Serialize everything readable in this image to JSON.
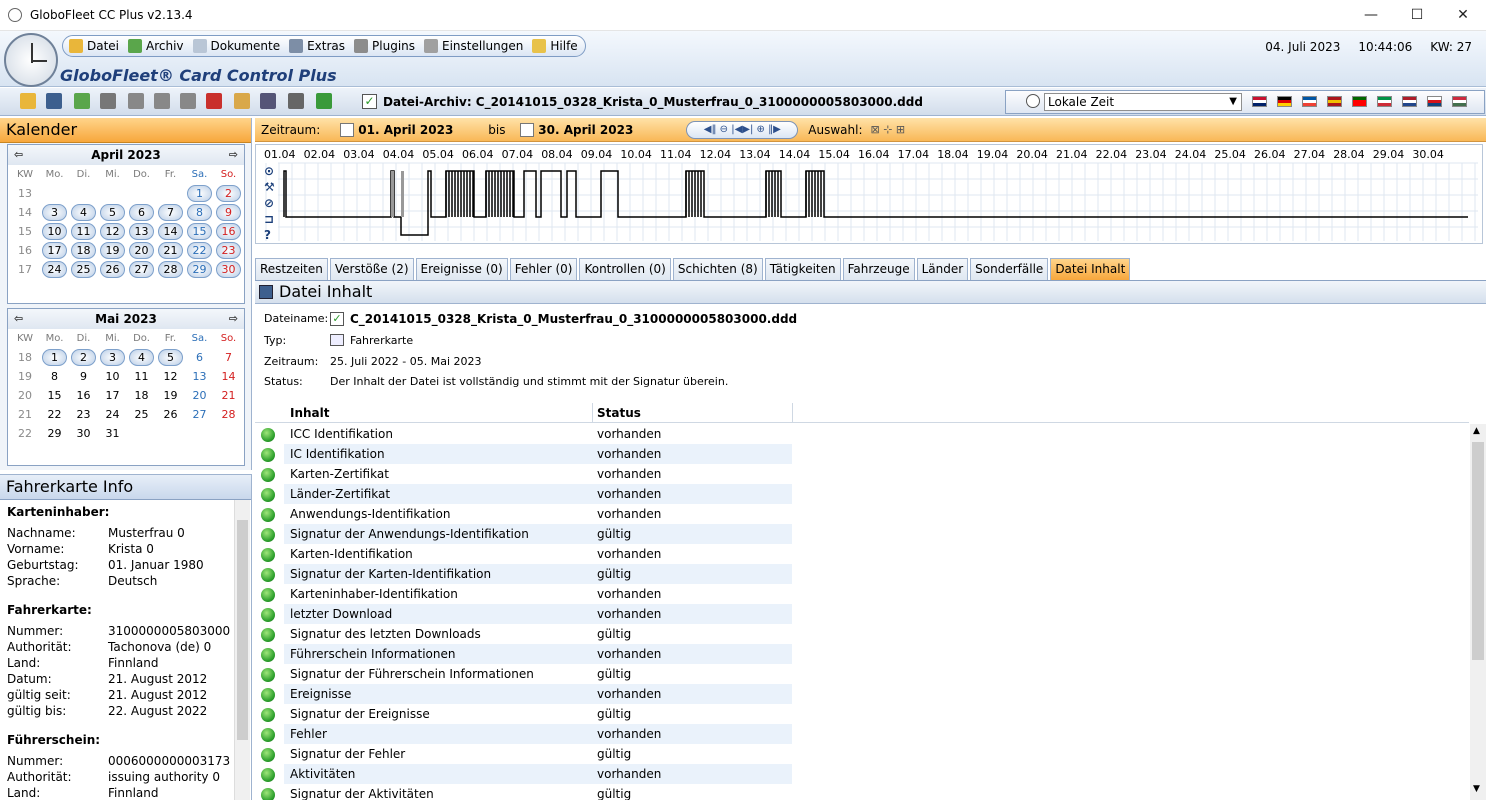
{
  "window": {
    "title": "GloboFleet CC Plus v2.13.4"
  },
  "menu": [
    {
      "label": "Datei",
      "color": "#e9b63a"
    },
    {
      "label": "Archiv",
      "color": "#5aa64b"
    },
    {
      "label": "Dokumente",
      "color": "#b9c6d6"
    },
    {
      "label": "Extras",
      "color": "#7d8ea6"
    },
    {
      "label": "Plugins",
      "color": "#8c8c8c"
    },
    {
      "label": "Einstellungen",
      "color": "#a0a0a0"
    },
    {
      "label": "Hilfe",
      "color": "#e8c24a"
    }
  ],
  "brand": "GloboFleet® Card Control Plus",
  "datetime": {
    "date": "04. Juli 2023",
    "time": "10:44:06",
    "kw": "KW: 27"
  },
  "archive_label": "Datei-Archiv: C_20141015_0328_Krista_0_Musterfrau_0_3100000005803000.ddd",
  "timezone": "Lokale Zeit",
  "calendar": {
    "title": "Kalender",
    "weekday_headers": [
      "KW",
      "Mo.",
      "Di.",
      "Mi.",
      "Do.",
      "Fr.",
      "Sa.",
      "So."
    ],
    "months": [
      {
        "name": "April 2023",
        "weeks": [
          {
            "kw": "13",
            "days": [
              "",
              "",
              "",
              "",
              "",
              "1",
              "2"
            ],
            "hl": [
              0,
              0,
              0,
              0,
              0,
              1,
              1
            ]
          },
          {
            "kw": "14",
            "days": [
              "3",
              "4",
              "5",
              "6",
              "7",
              "8",
              "9"
            ],
            "hl": [
              1,
              1,
              1,
              1,
              1,
              1,
              1
            ]
          },
          {
            "kw": "15",
            "days": [
              "10",
              "11",
              "12",
              "13",
              "14",
              "15",
              "16"
            ],
            "hl": [
              1,
              1,
              1,
              1,
              1,
              1,
              1
            ]
          },
          {
            "kw": "16",
            "days": [
              "17",
              "18",
              "19",
              "20",
              "21",
              "22",
              "23"
            ],
            "hl": [
              1,
              1,
              1,
              1,
              1,
              1,
              1
            ]
          },
          {
            "kw": "17",
            "days": [
              "24",
              "25",
              "26",
              "27",
              "28",
              "29",
              "30"
            ],
            "hl": [
              1,
              1,
              1,
              1,
              1,
              1,
              1
            ]
          }
        ]
      },
      {
        "name": "Mai 2023",
        "weeks": [
          {
            "kw": "18",
            "days": [
              "1",
              "2",
              "3",
              "4",
              "5",
              "6",
              "7"
            ],
            "hl": [
              1,
              1,
              1,
              1,
              1,
              0,
              0
            ]
          },
          {
            "kw": "19",
            "days": [
              "8",
              "9",
              "10",
              "11",
              "12",
              "13",
              "14"
            ],
            "hl": [
              0,
              0,
              0,
              0,
              0,
              0,
              0
            ]
          },
          {
            "kw": "20",
            "days": [
              "15",
              "16",
              "17",
              "18",
              "19",
              "20",
              "21"
            ],
            "hl": [
              0,
              0,
              0,
              0,
              0,
              0,
              0
            ]
          },
          {
            "kw": "21",
            "days": [
              "22",
              "23",
              "24",
              "25",
              "26",
              "27",
              "28"
            ],
            "hl": [
              0,
              0,
              0,
              0,
              0,
              0,
              0
            ]
          },
          {
            "kw": "22",
            "days": [
              "29",
              "30",
              "31",
              "",
              "",
              "",
              ""
            ],
            "hl": [
              0,
              0,
              0,
              0,
              0,
              0,
              0
            ]
          }
        ]
      }
    ]
  },
  "fahrerkarte": {
    "title": "Fahrerkarte Info",
    "sections": [
      {
        "heading": "Karteninhaber:",
        "rows": [
          [
            "Nachname:",
            "Musterfrau 0"
          ],
          [
            "Vorname:",
            "Krista 0"
          ],
          [
            "Geburtstag:",
            "01. Januar 1980"
          ],
          [
            "Sprache:",
            "Deutsch"
          ]
        ]
      },
      {
        "heading": "Fahrerkarte:",
        "rows": [
          [
            "Nummer:",
            "3100000005803000"
          ],
          [
            "Authorität:",
            "Tachonova (de) 0"
          ],
          [
            "Land:",
            "Finnland"
          ],
          [
            "Datum:",
            "21. August 2012"
          ],
          [
            "gültig seit:",
            "21. August 2012"
          ],
          [
            "gültig bis:",
            "22. August 2022"
          ]
        ]
      },
      {
        "heading": "Führerschein:",
        "rows": [
          [
            "Nummer:",
            "0006000000003173"
          ],
          [
            "Authorität:",
            "issuing authority 0"
          ],
          [
            "Land:",
            "Finnland"
          ]
        ]
      }
    ]
  },
  "zeitraum": {
    "label": "Zeitraum:",
    "from": "01. April 2023",
    "bis": "bis",
    "to": "30. April 2023",
    "auswahl": "Auswahl:"
  },
  "timeline": {
    "dates": [
      "01.04",
      "02.04",
      "03.04",
      "04.04",
      "05.04",
      "06.04",
      "07.04",
      "08.04",
      "09.04",
      "10.04",
      "11.04",
      "12.04",
      "13.04",
      "14.04",
      "15.04",
      "16.04",
      "17.04",
      "18.04",
      "19.04",
      "20.04",
      "21.04",
      "22.04",
      "23.04",
      "24.04",
      "25.04",
      "26.04",
      "27.04",
      "28.04",
      "29.04",
      "30.04"
    ],
    "row_icons": [
      "⊙",
      "⚒",
      "⊘",
      "⊐",
      "?"
    ]
  },
  "tabs": [
    "Restzeiten",
    "Verstöße (2)",
    "Ereignisse (0)",
    "Fehler (0)",
    "Kontrollen (0)",
    "Schichten (8)",
    "Tätigkeiten",
    "Fahrzeuge",
    "Länder",
    "Sonderfälle",
    "Datei Inhalt"
  ],
  "active_tab": "Datei Inhalt",
  "datei_inhalt": {
    "title": "Datei Inhalt",
    "dateiname_label": "Dateiname:",
    "dateiname": "C_20141015_0328_Krista_0_Musterfrau_0_3100000005803000.ddd",
    "typ_label": "Typ:",
    "typ": "Fahrerkarte",
    "zeitraum_label": "Zeitraum:",
    "zeitraum": "25. Juli 2022 - 05. Mai 2023",
    "status_label": "Status:",
    "status": "Der Inhalt der Datei ist vollständig und stimmt mit der Signatur überein.",
    "col_inhalt": "Inhalt",
    "col_status": "Status",
    "rows": [
      [
        "ICC Identifikation",
        "vorhanden"
      ],
      [
        "IC Identifikation",
        "vorhanden"
      ],
      [
        "Karten-Zertifikat",
        "vorhanden"
      ],
      [
        "Länder-Zertifikat",
        "vorhanden"
      ],
      [
        "Anwendungs-Identifikation",
        "vorhanden"
      ],
      [
        "Signatur der Anwendungs-Identifikation",
        "gültig"
      ],
      [
        "Karten-Identifikation",
        "vorhanden"
      ],
      [
        "Signatur der Karten-Identifikation",
        "gültig"
      ],
      [
        "Karteninhaber-Identifikation",
        "vorhanden"
      ],
      [
        "letzter Download",
        "vorhanden"
      ],
      [
        "Signatur des letzten Downloads",
        "gültig"
      ],
      [
        "Führerschein Informationen",
        "vorhanden"
      ],
      [
        "Signatur der Führerschein Informationen",
        "gültig"
      ],
      [
        "Ereignisse",
        "vorhanden"
      ],
      [
        "Signatur der Ereignisse",
        "gültig"
      ],
      [
        "Fehler",
        "vorhanden"
      ],
      [
        "Signatur der Fehler",
        "gültig"
      ],
      [
        "Aktivitäten",
        "vorhanden"
      ],
      [
        "Signatur der Aktivitäten",
        "gültig"
      ]
    ]
  }
}
